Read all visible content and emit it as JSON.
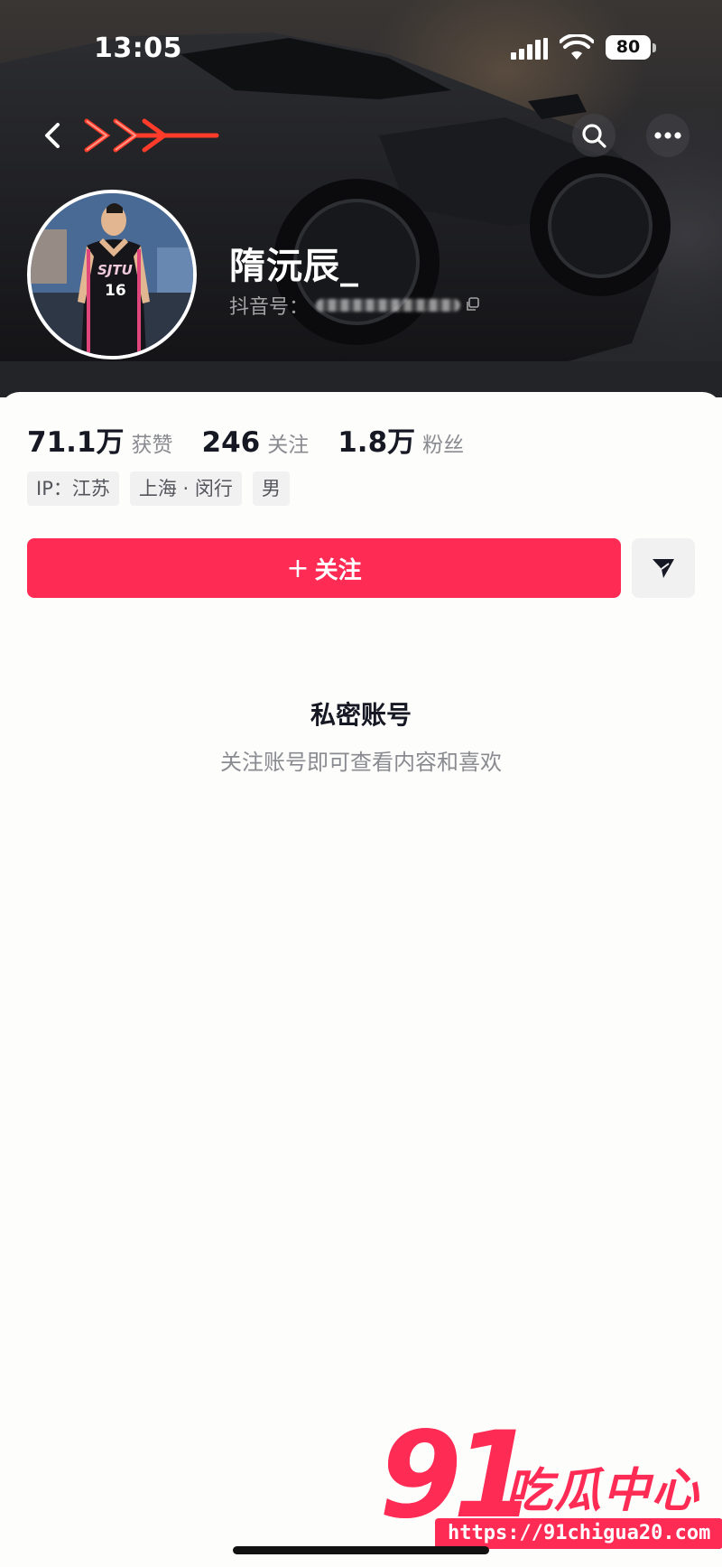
{
  "status_bar": {
    "time": "13:05",
    "battery": "80"
  },
  "profile": {
    "username": "隋沅辰_",
    "douyin_id_label": "抖音号：",
    "avatar_jersey_team": "SJTU",
    "avatar_jersey_number": "16"
  },
  "stats": [
    {
      "value": "71.1万",
      "label": "获赞"
    },
    {
      "value": "246",
      "label": "关注"
    },
    {
      "value": "1.8万",
      "label": "粉丝"
    }
  ],
  "tags": [
    "IP：江苏",
    "上海 · 闵行",
    "男"
  ],
  "actions": {
    "follow_label": "关注",
    "follow_prefix": "+"
  },
  "private_notice": {
    "title": "私密账号",
    "description": "关注账号即可查看内容和喜欢"
  },
  "watermark": {
    "big": "91",
    "text": "吃瓜中心",
    "url": "https://91chigua20.com"
  },
  "colors": {
    "accent": "#fe2c55",
    "text_primary": "#161823",
    "text_secondary": "#8a8b91"
  },
  "icons": [
    "back-icon",
    "search-icon",
    "more-icon",
    "share-icon",
    "copy-icon",
    "wifi-icon",
    "signal-icon"
  ]
}
